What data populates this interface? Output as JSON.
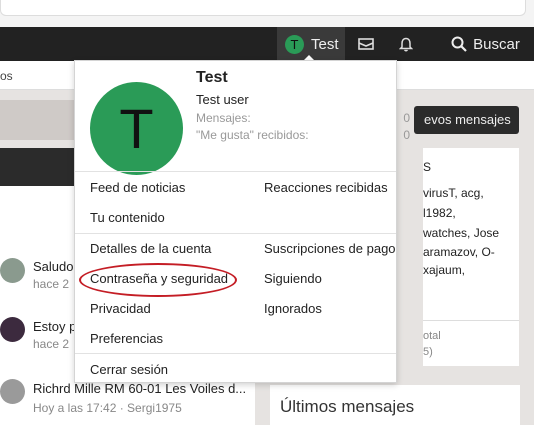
{
  "navbar": {
    "username": "Test",
    "avatar_letter": "T",
    "search_label": "Buscar",
    "inbox_icon": "envelope-icon",
    "alerts_icon": "bell-icon",
    "search_icon": "search-icon"
  },
  "subnav": {
    "text": "os"
  },
  "background": {
    "new_messages_button": "evos mensajes",
    "threads": [
      {
        "title": "Saludo",
        "sub": "hace 2"
      },
      {
        "title": "Estoy p",
        "sub": "hace 2"
      },
      {
        "title": "Richrd Mille RM 60-01 Les Voiles d...",
        "sub": "Hoy a las 17:42 · Sergi1975"
      }
    ],
    "right_panel": {
      "heading": "S",
      "lines": [
        "virusT, acg,",
        "l1982,",
        "watches, Jose",
        "aramazov, O-",
        "xajaum,"
      ],
      "footer_label": "otal",
      "footer_value": "5)"
    },
    "latest_title": "Últimos mensajes"
  },
  "menu": {
    "avatar_letter": "T",
    "name": "Test",
    "role": "Test user",
    "stats": [
      {
        "label": "Mensajes:",
        "value": "0"
      },
      {
        "label": "\"Me gusta\" recibidos:",
        "value": "0"
      }
    ],
    "links_left": [
      "Feed de noticias",
      "Tu contenido",
      "Detalles de la cuenta",
      "Contraseña y seguridad",
      "Privacidad",
      "Preferencias"
    ],
    "links_right": [
      "Reacciones recibidas",
      "Suscripciones de pago",
      "Siguiendo",
      "Ignorados"
    ],
    "logout": "Cerrar sesión",
    "highlight_color": "#c41d25",
    "avatar_color": "#2a9b57"
  }
}
